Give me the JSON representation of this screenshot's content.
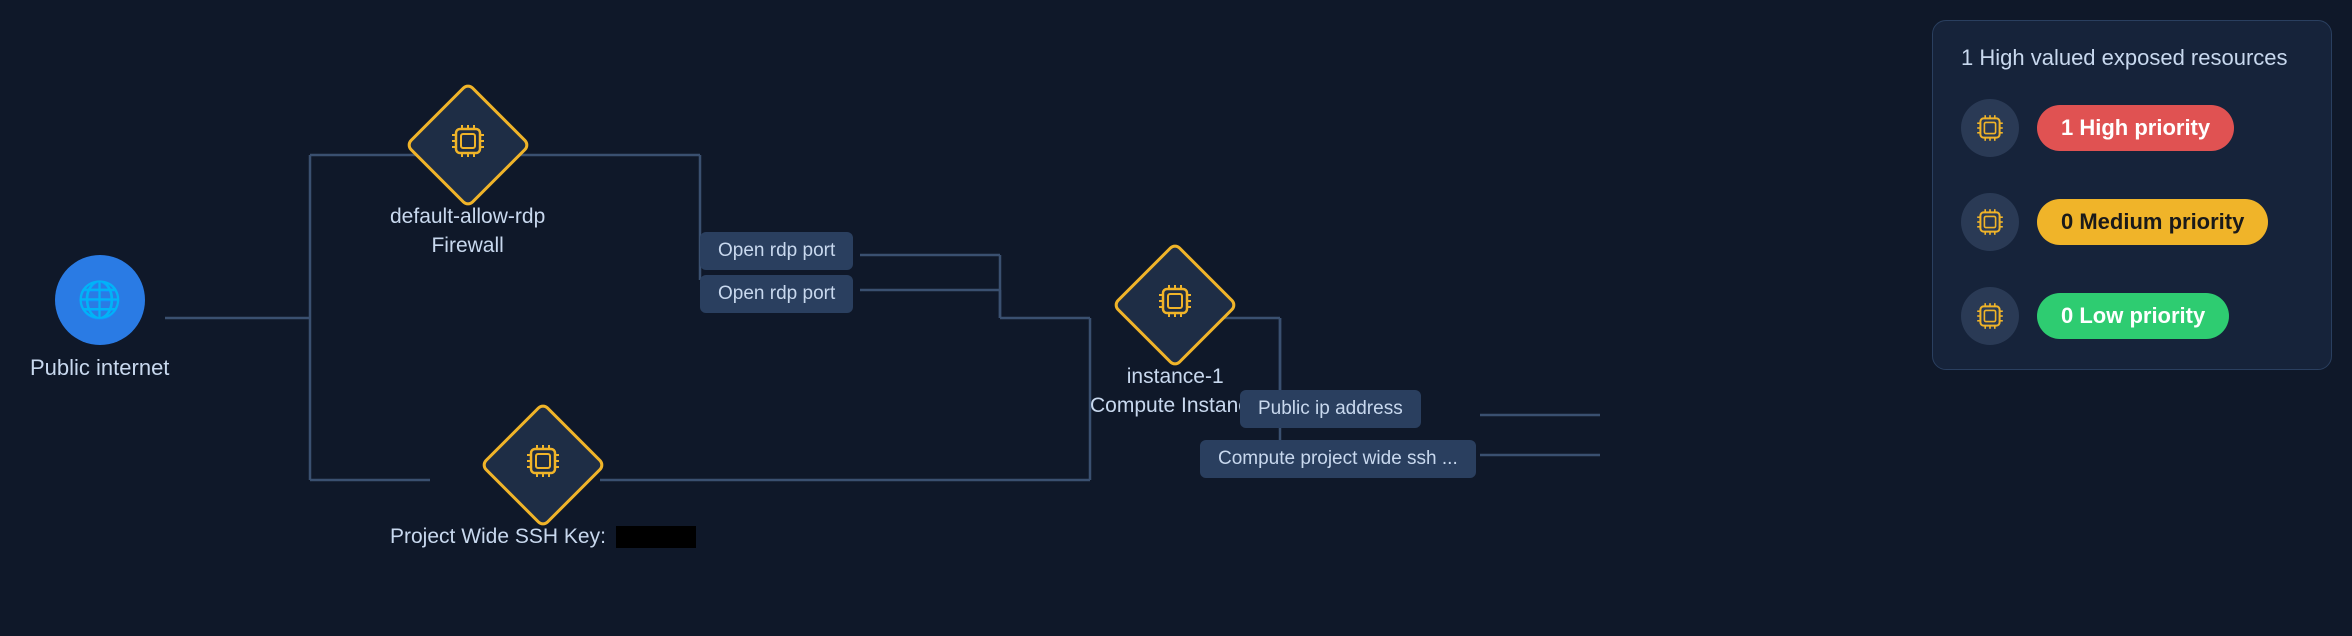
{
  "nodes": {
    "public_internet": {
      "label": "Public internet",
      "icon": "🌐"
    },
    "firewall": {
      "label": "default-allow-rdp",
      "sublabel": "Firewall",
      "icon": "⬡"
    },
    "ssh_key": {
      "label": "Project Wide SSH Key:",
      "sublabel": ""
    },
    "instance": {
      "label": "instance-1",
      "sublabel": "Compute Instance"
    }
  },
  "tags": {
    "rdp1": "Open rdp port",
    "rdp2": "Open rdp port",
    "public_ip": "Public ip address",
    "compute_ssh": "Compute project wide ssh ..."
  },
  "panel": {
    "title": "1 High valued exposed resources",
    "rows": [
      {
        "count": 1,
        "priority": "High priority",
        "type": "high"
      },
      {
        "count": 0,
        "priority": "Medium priority",
        "type": "medium"
      },
      {
        "count": 0,
        "priority": "Low priority",
        "type": "low"
      }
    ]
  }
}
